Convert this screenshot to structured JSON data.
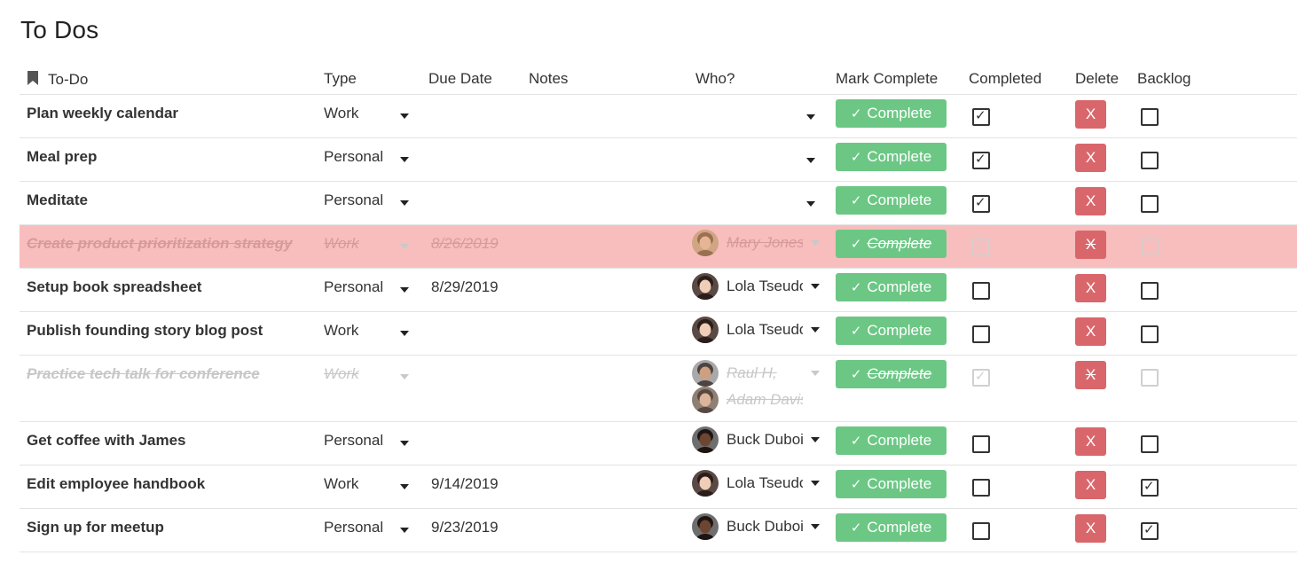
{
  "page": {
    "title": "To Dos"
  },
  "columns": {
    "todo": "To-Do",
    "type": "Type",
    "due_date": "Due Date",
    "notes": "Notes",
    "who": "Who?",
    "mark_complete": "Mark Complete",
    "completed": "Completed",
    "delete": "Delete",
    "backlog": "Backlog"
  },
  "colors": {
    "complete_button": "#6cc785",
    "delete_button": "#d9666b",
    "overdue_row": "#f8bdbd"
  },
  "buttons": {
    "complete_label": "Complete",
    "delete_label": "X"
  },
  "rows": [
    {
      "task": "Plan weekly calendar",
      "type": "Work",
      "due": "",
      "notes": "",
      "who": [],
      "completed": true,
      "backlog": false,
      "done_style": false,
      "highlight": false
    },
    {
      "task": "Meal prep",
      "type": "Personal",
      "due": "",
      "notes": "",
      "who": [],
      "completed": true,
      "backlog": false,
      "done_style": false,
      "highlight": false
    },
    {
      "task": "Meditate",
      "type": "Personal",
      "due": "",
      "notes": "",
      "who": [],
      "completed": true,
      "backlog": false,
      "done_style": false,
      "highlight": false
    },
    {
      "task": "Create product prioritization strategy",
      "type": "Work",
      "due": "8/26/2019",
      "notes": "",
      "who": [
        {
          "name": "Mary Jones"
        }
      ],
      "completed": true,
      "backlog": false,
      "done_style": true,
      "highlight": true
    },
    {
      "task": "Setup book spreadsheet",
      "type": "Personal",
      "due": "8/29/2019",
      "notes": "",
      "who": [
        {
          "name": "Lola Tseudonym"
        }
      ],
      "completed": false,
      "backlog": false,
      "done_style": false,
      "highlight": false
    },
    {
      "task": "Publish founding story blog post",
      "type": "Work",
      "due": "",
      "notes": "",
      "who": [
        {
          "name": "Lola Tseudonym"
        }
      ],
      "completed": false,
      "backlog": false,
      "done_style": false,
      "highlight": false
    },
    {
      "task": "Practice tech talk for conference",
      "type": "Work",
      "due": "",
      "notes": "",
      "who": [
        {
          "name": "Raul H,"
        },
        {
          "name": "Adam Davis"
        }
      ],
      "completed": true,
      "backlog": false,
      "done_style": true,
      "highlight": false
    },
    {
      "task": "Get coffee with James",
      "type": "Personal",
      "due": "",
      "notes": "",
      "who": [
        {
          "name": "Buck Dubois"
        }
      ],
      "completed": false,
      "backlog": false,
      "done_style": false,
      "highlight": false
    },
    {
      "task": "Edit employee handbook",
      "type": "Work",
      "due": "9/14/2019",
      "notes": "",
      "who": [
        {
          "name": "Lola Tseudonym"
        }
      ],
      "completed": false,
      "backlog": true,
      "done_style": false,
      "highlight": false
    },
    {
      "task": "Sign up for meetup",
      "type": "Personal",
      "due": "9/23/2019",
      "notes": "",
      "who": [
        {
          "name": "Buck Dubois"
        }
      ],
      "completed": false,
      "backlog": true,
      "done_style": false,
      "highlight": false
    }
  ]
}
